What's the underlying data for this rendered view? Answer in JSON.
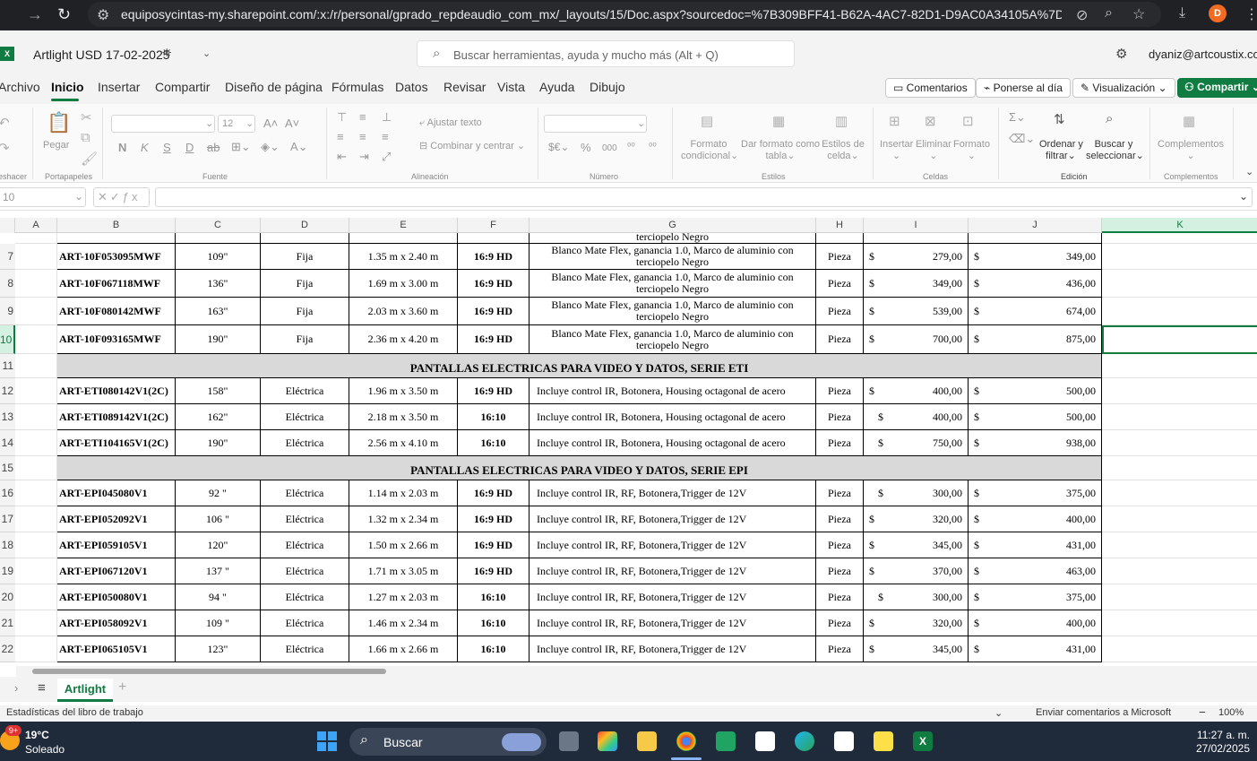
{
  "browser": {
    "url": "equiposycintas-my.sharepoint.com/:x:/r/personal/gprado_repdeaudio_com_mx/_layouts/15/Doc.aspx?sourcedoc=%7B309BFF41-B62A-4AC7-82D1-D9AC0A34105A%7D...",
    "profile_initial": "D"
  },
  "app": {
    "title": "Artlight USD 17-02-2025",
    "search_placeholder": "Buscar herramientas, ayuda y mucho más (Alt + Q)",
    "user": "dyaniz@artcoustix.com"
  },
  "menu": {
    "tabs": [
      "Archivo",
      "Inicio",
      "Insertar",
      "Compartir",
      "Diseño de página",
      "Fórmulas",
      "Datos",
      "Revisar",
      "Vista",
      "Ayuda",
      "Dibujo"
    ],
    "comments": "Comentarios",
    "catchup": "Ponerse al día",
    "view": "Visualización",
    "share": "Compartir"
  },
  "ribbon": {
    "undo_group": "eshacer",
    "paste": "Pegar",
    "clipboard": "Portapapeles",
    "font_size": "12",
    "font_group": "Fuente",
    "wrap_text": "Ajustar texto",
    "merge_center": "Combinar y centrar",
    "alignment_group": "Alineación",
    "number_group": "Número",
    "cond_format_1": "Formato",
    "cond_format_2": "condicional",
    "table_format_1": "Dar formato como",
    "table_format_2": "tabla",
    "cell_styles_1": "Estilos de",
    "cell_styles_2": "celda",
    "styles_group": "Estilos",
    "insert": "Insertar",
    "delete": "Eliminar",
    "format": "Formato",
    "cells_group": "Celdas",
    "sort_1": "Ordenar y",
    "sort_2": "filtrar",
    "find_1": "Buscar y",
    "find_2": "seleccionar",
    "editing_group": "Edición",
    "addins": "Complementos",
    "addins_group": "Complementos"
  },
  "formula_bar": {
    "name_box": "10"
  },
  "grid": {
    "columns": [
      "A",
      "B",
      "C",
      "D",
      "E",
      "F",
      "G",
      "H",
      "I",
      "J",
      "K"
    ],
    "partial_row_text": "terciopelo Negro",
    "rows": [
      {
        "n": "7",
        "type": "item",
        "code": "ART-10F053095MWF",
        "size": "109\"",
        "mount": "Fija",
        "dims": "1.35 m x 2.40 m",
        "ratio": "16:9 HD",
        "desc": "Blanco Mate Flex, ganancia 1.0, Marco de aluminio con terciopelo Negro",
        "unit": "Pieza",
        "p1": "279,00",
        "p2": "349,00"
      },
      {
        "n": "8",
        "type": "item",
        "code": "ART-10F067118MWF",
        "size": "136\"",
        "mount": "Fija",
        "dims": "1.69 m x 3.00 m",
        "ratio": "16:9 HD",
        "desc": "Blanco Mate Flex, ganancia 1.0, Marco de aluminio con terciopelo Negro",
        "unit": "Pieza",
        "p1": "349,00",
        "p2": "436,00"
      },
      {
        "n": "9",
        "type": "item",
        "code": "ART-10F080142MWF",
        "size": "163\"",
        "mount": "Fija",
        "dims": "2.03 m x 3.60 m",
        "ratio": "16:9 HD",
        "desc": "Blanco Mate Flex, ganancia 1.0, Marco de aluminio con terciopelo Negro",
        "unit": "Pieza",
        "p1": "539,00",
        "p2": "674,00"
      },
      {
        "n": "10",
        "type": "item",
        "code": "ART-10F093165MWF",
        "size": "190\"",
        "mount": "Fija",
        "dims": "2.36 m x 4.20 m",
        "ratio": "16:9 HD",
        "desc": "Blanco Mate Flex, ganancia 1.0, Marco de aluminio con terciopelo Negro",
        "unit": "Pieza",
        "p1": "700,00",
        "p2": "875,00"
      },
      {
        "n": "11",
        "type": "section",
        "title": "PANTALLAS ELECTRICAS PARA VIDEO Y DATOS, SERIE ETI"
      },
      {
        "n": "12",
        "type": "item",
        "code": "ART-ETI080142V1(2C)",
        "size": "158\"",
        "mount": "Eléctrica",
        "dims": "1.96 m x 3.50 m",
        "ratio": "16:9 HD",
        "desc": "Incluye control IR, Botonera, Housing octagonal de acero",
        "unit": "Pieza",
        "p1": "400,00",
        "p2": "500,00"
      },
      {
        "n": "13",
        "type": "item",
        "code": "ART-ETI089142V1(2C)",
        "size": "162\"",
        "mount": "Eléctrica",
        "dims": "2.18 m x 3.50 m",
        "ratio": "16:10",
        "desc": "Incluye control IR, Botonera, Housing octagonal de acero",
        "unit": "Pieza",
        "p1": "400,00",
        "p2": "500,00",
        "ind": true
      },
      {
        "n": "14",
        "type": "item",
        "code": "ART-ETI104165V1(2C)",
        "size": "190\"",
        "mount": "Eléctrica",
        "dims": "2.56 m x 4.10 m",
        "ratio": "16:10",
        "desc": "Incluye control IR, Botonera, Housing octagonal de acero",
        "unit": "Pieza",
        "p1": "750,00",
        "p2": "938,00",
        "ind": true
      },
      {
        "n": "15",
        "type": "section",
        "title": "PANTALLAS ELECTRICAS PARA VIDEO Y DATOS, SERIE EPI"
      },
      {
        "n": "16",
        "type": "item",
        "code": "ART-EPI045080V1",
        "size": "92 \"",
        "mount": "Eléctrica",
        "dims": "1.14 m x 2.03 m",
        "ratio": "16:9 HD",
        "desc": "Incluye control IR, RF, Botonera,Trigger de 12V",
        "unit": "Pieza",
        "p1": "300,00",
        "p2": "375,00",
        "ind": true
      },
      {
        "n": "17",
        "type": "item",
        "code": "ART-EPI052092V1",
        "size": "106 \"",
        "mount": "Eléctrica",
        "dims": "1.32 m x 2.34 m",
        "ratio": "16:9 HD",
        "desc": "Incluye control IR, RF, Botonera,Trigger de 12V",
        "unit": "Pieza",
        "p1": "320,00",
        "p2": "400,00"
      },
      {
        "n": "18",
        "type": "item",
        "code": "ART-EPI059105V1",
        "size": "120\"",
        "mount": "Eléctrica",
        "dims": "1.50 m x 2.66 m",
        "ratio": "16:9 HD",
        "desc": "Incluye control IR, RF, Botonera,Trigger de 12V",
        "unit": "Pieza",
        "p1": "345,00",
        "p2": "431,00"
      },
      {
        "n": "19",
        "type": "item",
        "code": "ART-EPI067120V1",
        "size": "137 \"",
        "mount": "Eléctrica",
        "dims": "1.71 m x 3.05 m",
        "ratio": "16:9 HD",
        "desc": "Incluye control IR, RF, Botonera,Trigger de 12V",
        "unit": "Pieza",
        "p1": "370,00",
        "p2": "463,00"
      },
      {
        "n": "20",
        "type": "item",
        "code": "ART-EPI050080V1",
        "size": "94 \"",
        "mount": "Eléctrica",
        "dims": "1.27 m x 2.03 m",
        "ratio": "16:10",
        "desc": "Incluye control IR, RF, Botonera,Trigger de 12V",
        "unit": "Pieza",
        "p1": "300,00",
        "p2": "375,00",
        "ind": true
      },
      {
        "n": "21",
        "type": "item",
        "code": "ART-EPI058092V1",
        "size": "109 \"",
        "mount": "Eléctrica",
        "dims": "1.46 m x 2.34 m",
        "ratio": "16:10",
        "desc": "Incluye control IR, RF, Botonera,Trigger de 12V",
        "unit": "Pieza",
        "p1": "320,00",
        "p2": "400,00"
      },
      {
        "n": "22",
        "type": "item",
        "code": "ART-EPI065105V1",
        "size": "123\"",
        "mount": "Eléctrica",
        "dims": "1.66 m x 2.66 m",
        "ratio": "16:10",
        "desc": "Incluye control IR, RF, Botonera,Trigger de 12V",
        "unit": "Pieza",
        "p1": "345,00",
        "p2": "431,00"
      }
    ],
    "currency": "$"
  },
  "sheet": {
    "name": "Artlight"
  },
  "status": {
    "left": "Estadísticas del libro de trabajo",
    "feedback": "Enviar comentarios a Microsoft",
    "zoom": "100%"
  },
  "taskbar": {
    "temp": "19°C",
    "weather": "Soleado",
    "badge": "9+",
    "search": "Buscar",
    "time": "11:27 a. m.",
    "date": "27/02/2025"
  }
}
